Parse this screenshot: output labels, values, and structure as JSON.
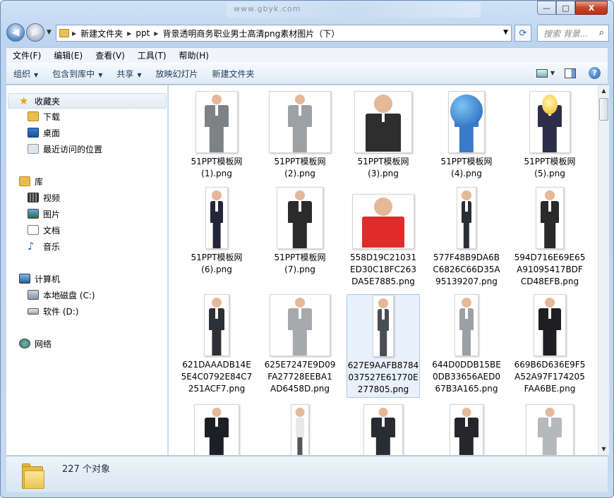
{
  "window": {
    "blurred_title": "www.gbyk.com",
    "caption": {
      "min": "—",
      "max": "□",
      "close": "X"
    }
  },
  "address_bar": {
    "crumbs": [
      "新建文件夹",
      "ppt",
      "背景透明商务职业男士高清png素材图片（下）"
    ],
    "search_placeholder": "搜索 背景..."
  },
  "menu": [
    "文件(F)",
    "编辑(E)",
    "查看(V)",
    "工具(T)",
    "帮助(H)"
  ],
  "toolbar": {
    "organize": "组织",
    "include_in_library": "包含到库中",
    "share": "共享",
    "slideshow": "放映幻灯片",
    "new_folder": "新建文件夹"
  },
  "sidebar": {
    "favorites": "收藏夹",
    "downloads": "下载",
    "desktop": "桌面",
    "recent": "最近访问的位置",
    "libraries": "库",
    "videos": "视频",
    "pictures": "图片",
    "documents": "文档",
    "music": "音乐",
    "computer": "计算机",
    "local_disk": "本地磁盘 (C:)",
    "software_disk": "软件 (D:)",
    "network": "网络"
  },
  "files": [
    "51PPT模板网(1).png",
    "51PPT模板网(2).png",
    "51PPT模板网(3).png",
    "51PPT模板网(4).png",
    "51PPT模板网(5).png",
    "51PPT模板网(6).png",
    "51PPT模板网(7).png",
    "558D19C21031ED30C18FC263DA5E7885.png",
    "577F48B9DA6BC6826C66D35A95139207.png",
    "594D716E69E65A91095417BDFCD48EFB.png",
    "621DAAADB14E5E4C0792E84C7251ACF7.png",
    "625E7247E9D09FA27728EEBA1AD6458D.png",
    "627E9AAFB8784037527E61770E277805.png",
    "644D0DDB15BE0DB33656AED067B3A165.png",
    "669B6D636E9F5A52A97F174205FAA6BE.png"
  ],
  "file_labels_wrapped": [
    [
      "51PPT模板网",
      "(1).png"
    ],
    [
      "51PPT模板网",
      "(2).png"
    ],
    [
      "51PPT模板网",
      "(3).png"
    ],
    [
      "51PPT模板网",
      "(4).png"
    ],
    [
      "51PPT模板网",
      "(5).png"
    ],
    [
      "51PPT模板网",
      "(6).png"
    ],
    [
      "51PPT模板网",
      "(7).png"
    ],
    [
      "558D19C21031",
      "ED30C18FC263",
      "DA5E7885.png"
    ],
    [
      "577F48B9DA6B",
      "C6826C66D35A",
      "95139207.png"
    ],
    [
      "594D716E69E65",
      "A91095417BDF",
      "CD48EFB.png"
    ],
    [
      "621DAAADB14E",
      "5E4C0792E84C7",
      "251ACF7.png"
    ],
    [
      "625E7247E9D09",
      "FA27728EEBA1",
      "AD6458D.png"
    ],
    [
      "627E9AAFB8784",
      "037527E61770E",
      "277805.png"
    ],
    [
      "644D0DDB15BE",
      "0DB33656AED0",
      "67B3A165.png"
    ],
    [
      "669B6D636E9F5",
      "A52A97F174205",
      "FAA6BE.png"
    ]
  ],
  "status": {
    "count": "227 个对象"
  }
}
